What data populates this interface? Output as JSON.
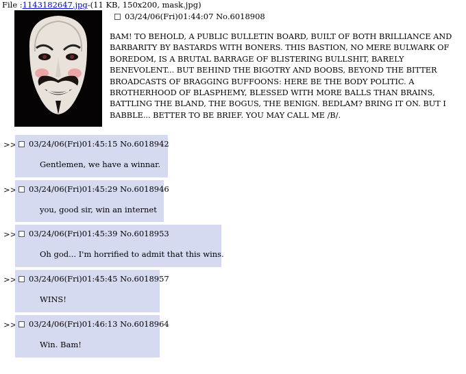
{
  "file": {
    "prefix": "File :",
    "filename": "1143182647.jpg",
    "info": "-(11 KB, 150x200, mask.jpg)"
  },
  "thumbnail": {
    "icon": "guy-fawkes-mask-image"
  },
  "op": {
    "header": "03/24/06(Fri)01:44:07 No.6018908",
    "text": "BAM! TO BEHOLD, A PUBLIC BULLETIN BOARD, BUILT OF BOTH BRILLIANCE AND BARBARITY BY BASTARDS WITH BONERS. THIS BASTION, NO MERE BULWARK OF BOREDOM, IS A BRUTAL BARRAGE OF BLISTERING BULLSHIT, BARELY BENEVOLENT... BUT BEHIND THE BIGOTRY AND BOOBS, BEYOND THE BITTER BROADCASTS OF BRAGGING BUFFOONS: HERE BE THE BODY POLITIC. A BROTHERHOOD OF BLASPHEMY, BLESSED WITH MORE BALLS THAN BRAINS, BATTLING THE BLAND, THE BOGUS, THE BENIGN. BEDLAM? BRING IT ON. BUT I BABBLE... BETTER TO BE BRIEF.  YOU MAY CALL ME /B/."
  },
  "replies": [
    {
      "arrow": ">>",
      "header": "03/24/06(Fri)01:45:15 No.6018942",
      "text": "Gentlemen, we have a winnar."
    },
    {
      "arrow": ">>",
      "header": "03/24/06(Fri)01:45:29 No.6018946",
      "text": "you, good sir, win an internet"
    },
    {
      "arrow": ">>",
      "header": "03/24/06(Fri)01:45:39 No.6018953",
      "text": "Oh god... I'm horrified to admit that this wins."
    },
    {
      "arrow": ">>",
      "header": "03/24/06(Fri)01:45:45 No.6018957",
      "text": "WINS!"
    },
    {
      "arrow": ">>",
      "header": "03/24/06(Fri)01:46:13 No.6018964",
      "text": "Win. Bam!"
    }
  ],
  "colors": {
    "reply_bg": "#d6daf0",
    "link": "#0000cc",
    "background": "#ffffff"
  }
}
